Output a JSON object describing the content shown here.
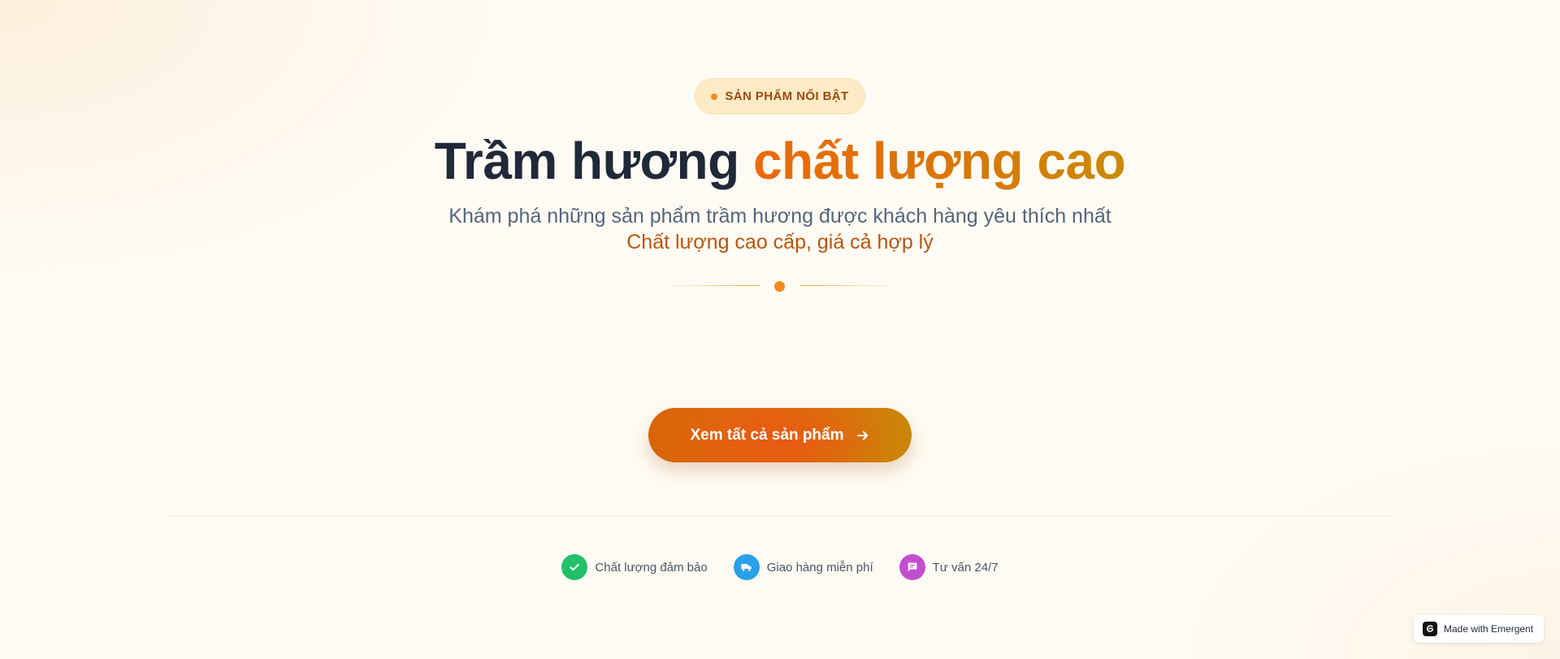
{
  "badge": {
    "label": "SẢN PHẨM NỔI BẬT",
    "dot_color": "#f08a24"
  },
  "hero": {
    "title_main": "Trầm hương",
    "title_accent": "chất lượng cao",
    "subtitle": "Khám phá những sản phẩm trầm hương được khách hàng yêu thích nhất",
    "tagline": "Chất lượng cao cấp, giá cả hợp lý"
  },
  "cta": {
    "label": "Xem tất cả sản phẩm",
    "icon": "arrow-right-icon"
  },
  "features": [
    {
      "label": "Chất lượng đảm bảo",
      "icon": "check-icon",
      "color": "#22c06b"
    },
    {
      "label": "Giao hàng miễn phí",
      "icon": "truck-icon",
      "color": "#2aa0e8"
    },
    {
      "label": "Tư vấn 24/7",
      "icon": "chat-icon",
      "color": "#c24fd0"
    }
  ],
  "footer_badge": {
    "label": "Made with Emergent",
    "icon": "emergent-logo-icon"
  },
  "colors": {
    "accent": "#ea6a0c",
    "title": "#1f2937",
    "background": "#fefbf4"
  }
}
